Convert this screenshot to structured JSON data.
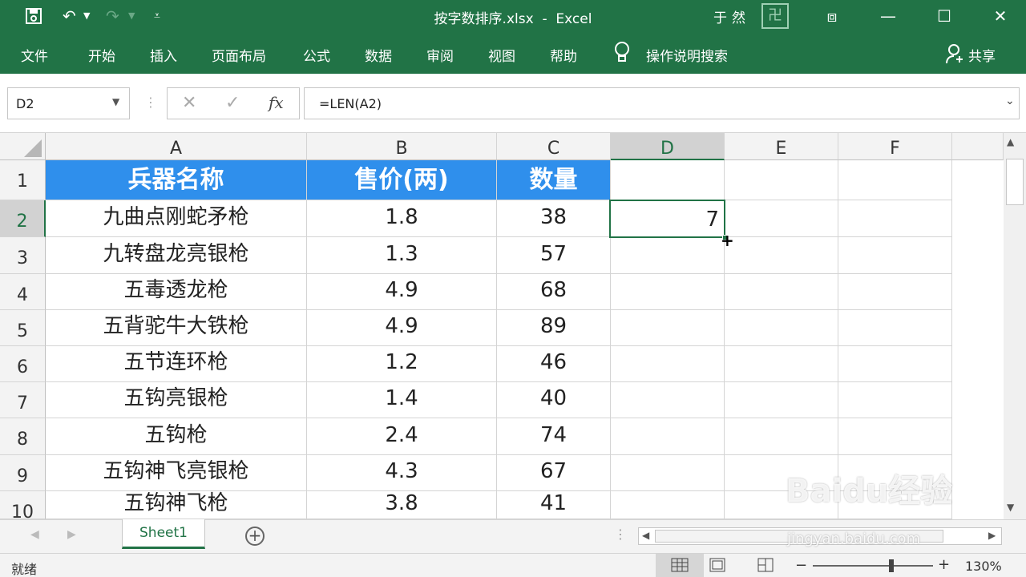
{
  "title_bar": {
    "title": "按字数排序.xlsx  -  Excel",
    "user": "于然",
    "account_icon": "卍",
    "undo_icon": "↶",
    "redo_icon": "↷"
  },
  "ribbon_tabs": [
    "文件",
    "开始",
    "插入",
    "页面布局",
    "公式",
    "数据",
    "审阅",
    "视图",
    "帮助"
  ],
  "tell_me": "操作说明搜索",
  "share": "共享",
  "name_box": "D2",
  "formula": "=LEN(A2)",
  "columns": [
    "A",
    "B",
    "C",
    "D",
    "E",
    "F"
  ],
  "rows": [
    "1",
    "2",
    "3",
    "4",
    "5",
    "6",
    "7",
    "8",
    "9",
    "10"
  ],
  "table": {
    "headers": [
      "兵器名称",
      "售价(两)",
      "数量"
    ],
    "data": [
      [
        "九曲点刚蛇矛枪",
        "1.8",
        "38"
      ],
      [
        "九转盘龙亮银枪",
        "1.3",
        "57"
      ],
      [
        "五毒透龙枪",
        "4.9",
        "68"
      ],
      [
        "五背驼牛大铁枪",
        "4.9",
        "89"
      ],
      [
        "五节连环枪",
        "1.2",
        "46"
      ],
      [
        "五钩亮银枪",
        "1.4",
        "40"
      ],
      [
        "五钩枪",
        "2.4",
        "74"
      ],
      [
        "五钩神飞亮银枪",
        "4.3",
        "67"
      ],
      [
        "五钩神飞枪",
        "3.8",
        "41"
      ]
    ]
  },
  "d2_value": "7",
  "sheet_tab": "Sheet1",
  "status": {
    "ready": "就绪",
    "zoom": "130%",
    "zoom_level": 0.65
  },
  "watermark": {
    "brand": "Baidu经验",
    "url": "jingyan.baidu.com"
  },
  "colors": {
    "ribbon": "#217346",
    "header_fill": "#2f8fec"
  }
}
